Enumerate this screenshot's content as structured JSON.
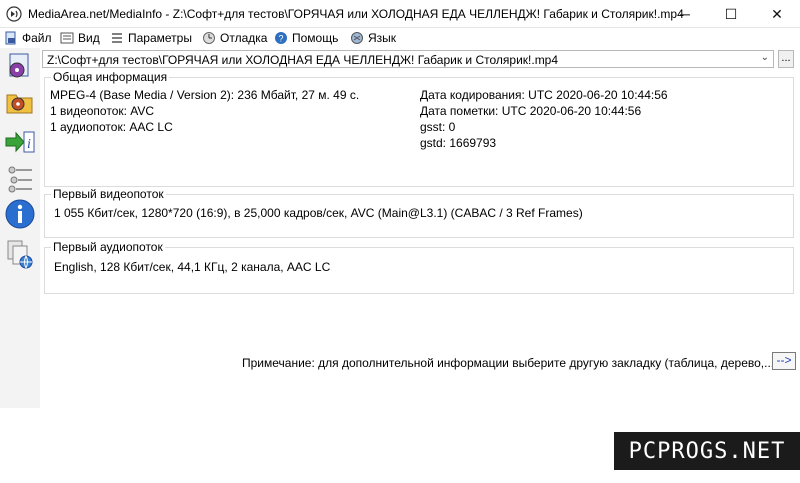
{
  "window": {
    "title": "MediaArea.net/MediaInfo - Z:\\Софт+для тестов\\ГОРЯЧАЯ или ХОЛОДНАЯ ЕДА ЧЕЛЛЕНДЖ! Габарик и Столярик!.mp4",
    "buttons": {
      "minimize": "─",
      "maximize": "☐",
      "close": "✕"
    }
  },
  "menu": [
    {
      "label": "Файл",
      "icon": "file-icon"
    },
    {
      "label": "Вид",
      "icon": "view-icon"
    },
    {
      "label": "Параметры",
      "icon": "options-icon"
    },
    {
      "label": "Отладка",
      "icon": "debug-icon"
    },
    {
      "label": "Помощь",
      "icon": "help-icon"
    },
    {
      "label": "Язык",
      "icon": "language-icon"
    }
  ],
  "sidebar": {
    "icons": [
      "open-file-icon",
      "open-folder-icon",
      "export-info-icon",
      "settings-icon",
      "about-info-icon",
      "website-icon"
    ]
  },
  "file_selector": {
    "value": "Z:\\Софт+для тестов\\ГОРЯЧАЯ или ХОЛОДНАЯ ЕДА ЧЕЛЛЕНДЖ! Габарик и Столярик!.mp4",
    "more_label": "..."
  },
  "general": {
    "title": "Общая информация",
    "left": [
      "MPEG-4 (Base Media / Version 2): 236 Мбайт, 27 м. 49 с.",
      "1 видеопоток: AVC",
      "1 аудиопоток: AAC LC"
    ],
    "right": [
      "Дата кодирования: UTC 2020-06-20 10:44:56",
      "Дата пометки: UTC 2020-06-20 10:44:56",
      "gsst: 0",
      "gstd: 1669793"
    ]
  },
  "video": {
    "title": "Первый видеопоток",
    "line": "1 055 Кбит/сек, 1280*720 (16:9), в 25,000 кадров/сек, AVC (Main@L3.1) (CABAC / 3 Ref Frames)"
  },
  "audio": {
    "title": "Первый аудиопоток",
    "line": "English, 128 Кбит/сек, 44,1 КГц, 2 канала, AAC LC"
  },
  "note": {
    "text": "Примечание: для дополнительной информации выберите другую закладку (таблица, дерево,...)",
    "button": "-->"
  },
  "watermark": "PCPROGS.NET"
}
